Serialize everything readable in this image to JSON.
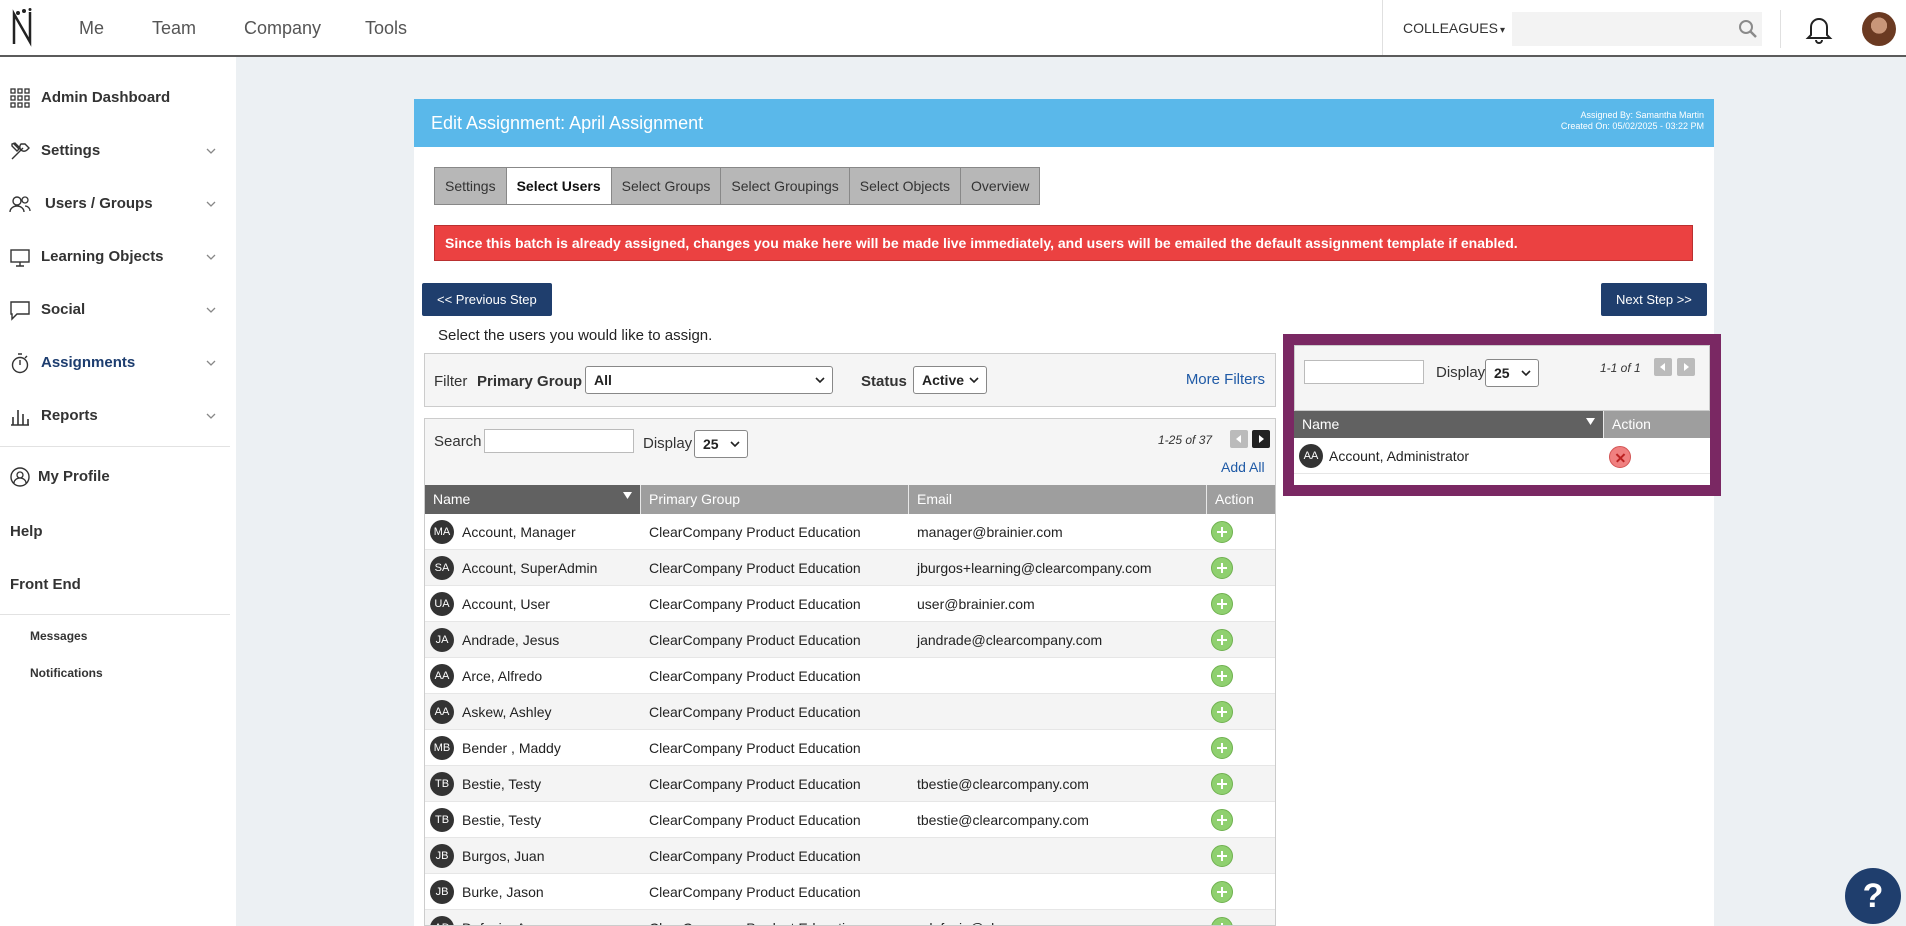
{
  "topnav": {
    "links": [
      "Me",
      "Team",
      "Company",
      "Tools"
    ],
    "colleagues_label": "COLLEAGUES",
    "search_placeholder": ""
  },
  "sidebar": {
    "items": [
      {
        "label": "Admin Dashboard",
        "icon": "grid-icon"
      },
      {
        "label": "Settings",
        "icon": "tools-icon"
      },
      {
        "label": "Users / Groups",
        "icon": "users-icon"
      },
      {
        "label": "Learning Objects",
        "icon": "monitor-icon"
      },
      {
        "label": "Social",
        "icon": "chat-icon"
      },
      {
        "label": "Assignments",
        "icon": "stopwatch-icon"
      },
      {
        "label": "Reports",
        "icon": "bar-chart-icon"
      }
    ],
    "my_profile": "My Profile",
    "help": "Help",
    "front_end": "Front End",
    "messages": "Messages",
    "notifications": "Notifications"
  },
  "panel": {
    "title": "Edit Assignment: April Assignment",
    "assigned_by": "Assigned By: Samantha Martin",
    "created_on": "Created On: 05/02/2025 - 03:22 PM",
    "tabs": [
      "Settings",
      "Select Users",
      "Select Groups",
      "Select Groupings",
      "Select Objects",
      "Overview"
    ],
    "active_tab": "Select Users",
    "alert": "Since this batch is already assigned, changes you make here will be made live immediately, and users will be emailed the default assignment template if enabled.",
    "prev_label": "<< Previous Step",
    "next_label": "Next Step >>",
    "instructions": "Select the users you would like to assign."
  },
  "filter": {
    "label": "Filter",
    "primary_group_label": "Primary Group",
    "primary_group_value": "All",
    "status_label": "Status",
    "status_value": "Active",
    "more_filters": "More Filters"
  },
  "user_list": {
    "search_label": "Search",
    "display_label": "Display",
    "display_value": "25",
    "pager": "1-25 of 37",
    "add_all": "Add All",
    "columns": [
      "Name",
      "Primary Group",
      "Email",
      "Action"
    ],
    "rows": [
      {
        "initials": "MA",
        "name": "Account, Manager",
        "group": "ClearCompany Product Education",
        "email": "manager@brainier.com"
      },
      {
        "initials": "SA",
        "name": "Account, SuperAdmin",
        "group": "ClearCompany Product Education",
        "email": "jburgos+learning@clearcompany.com"
      },
      {
        "initials": "UA",
        "name": "Account, User",
        "group": "ClearCompany Product Education",
        "email": "user@brainier.com"
      },
      {
        "initials": "JA",
        "name": "Andrade, Jesus",
        "group": "ClearCompany Product Education",
        "email": "jandrade@clearcompany.com"
      },
      {
        "initials": "AA",
        "name": "Arce, Alfredo",
        "group": "ClearCompany Product Education",
        "email": ""
      },
      {
        "initials": "AA",
        "name": "Askew, Ashley",
        "group": "ClearCompany Product Education",
        "email": ""
      },
      {
        "initials": "MB",
        "name": "Bender , Maddy",
        "group": "ClearCompany Product Education",
        "email": ""
      },
      {
        "initials": "TB",
        "name": "Bestie, Testy",
        "group": "ClearCompany Product Education",
        "email": "tbestie@clearcompany.com"
      },
      {
        "initials": "TB",
        "name": "Bestie, Testy",
        "group": "ClearCompany Product Education",
        "email": "tbestie@clearcompany.com"
      },
      {
        "initials": "JB",
        "name": "Burgos, Juan",
        "group": "ClearCompany Product Education",
        "email": ""
      },
      {
        "initials": "JB",
        "name": "Burke, Jason",
        "group": "ClearCompany Product Education",
        "email": ""
      },
      {
        "initials": "AD",
        "name": "Defazio, Anne",
        "group": "ClearCompany Product Education",
        "email": "adefazio@clearcompany.com"
      }
    ]
  },
  "selected_list": {
    "display_label": "Display",
    "display_value": "25",
    "pager": "1-1 of 1",
    "columns": [
      "Name",
      "Action"
    ],
    "rows": [
      {
        "initials": "AA",
        "name": "Account, Administrator"
      }
    ]
  },
  "help_label": "?",
  "colors": {
    "header_blue": "#5ab8ea",
    "navy": "#1f3e6d",
    "alert_red": "#eb4141",
    "highlight_purple": "#7a2863",
    "add_green": "#8fd06f"
  }
}
